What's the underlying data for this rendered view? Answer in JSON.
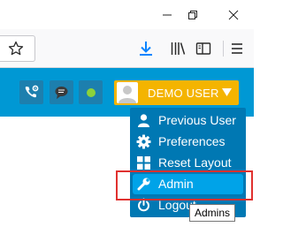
{
  "window": {
    "controls": {
      "minimize_icon": "minimize-icon",
      "restore_icon": "restore-icon",
      "close_icon": "close-icon"
    }
  },
  "browser_toolbar": {
    "icons": [
      "bookmark-star-icon",
      "download-icon",
      "library-icon",
      "sidebar-icon",
      "menu-icon"
    ],
    "accent_color": "#0a84ff"
  },
  "app_header": {
    "background_color": "#0098d4",
    "buttons": [
      "phone-settings-icon",
      "chat-icon",
      "status-online-icon"
    ],
    "status_color": "#8cd23a",
    "user_button": {
      "label": "DEMO USER",
      "color": "#f4b400"
    }
  },
  "user_menu": {
    "background_color": "#0078b3",
    "active_color": "#00a3e8",
    "items": [
      {
        "label": "Previous User",
        "icon": "user-icon",
        "active": false
      },
      {
        "label": "Preferences",
        "icon": "gear-icon",
        "active": false
      },
      {
        "label": "Reset Layout",
        "icon": "grid-icon",
        "active": false
      },
      {
        "label": "Admin",
        "icon": "wrench-icon",
        "active": true
      },
      {
        "label": "Logout",
        "icon": "power-icon",
        "active": false
      }
    ]
  },
  "tooltip": {
    "text": "Admins"
  },
  "highlight": {
    "color": "#e0312f",
    "target": "Admin"
  }
}
